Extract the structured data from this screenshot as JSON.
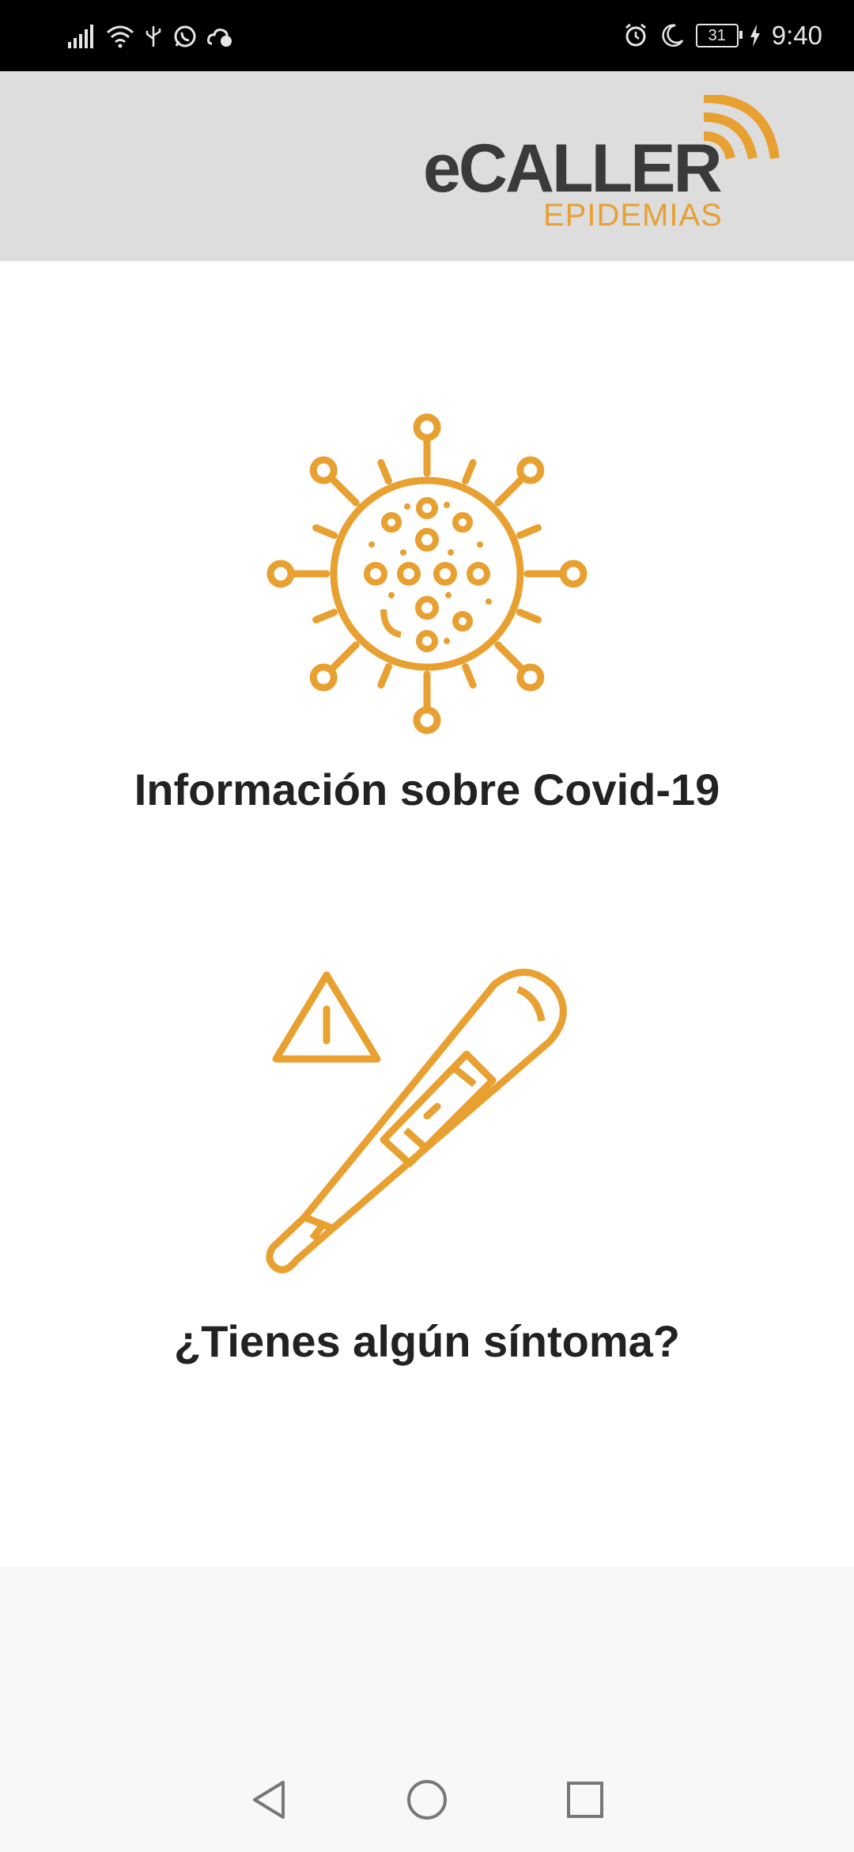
{
  "status_bar": {
    "time": "9:40",
    "battery_level": "31",
    "icons": [
      "signal-icon",
      "wifi-icon",
      "usb-icon",
      "whatsapp-icon",
      "weather-icon",
      "alarm-icon",
      "moon-icon",
      "charging-icon"
    ]
  },
  "header": {
    "logo_main": "eCALLER",
    "logo_sub": "EPIDEMIAS",
    "accent_color": "#e8a031"
  },
  "cards": [
    {
      "label": "Información sobre Covid-19",
      "icon": "virus-icon"
    },
    {
      "label": "¿Tienes algún síntoma?",
      "icon": "thermometer-warning-icon"
    }
  ],
  "nav_bar": {
    "buttons": [
      "back-icon",
      "home-icon",
      "recents-icon"
    ]
  }
}
